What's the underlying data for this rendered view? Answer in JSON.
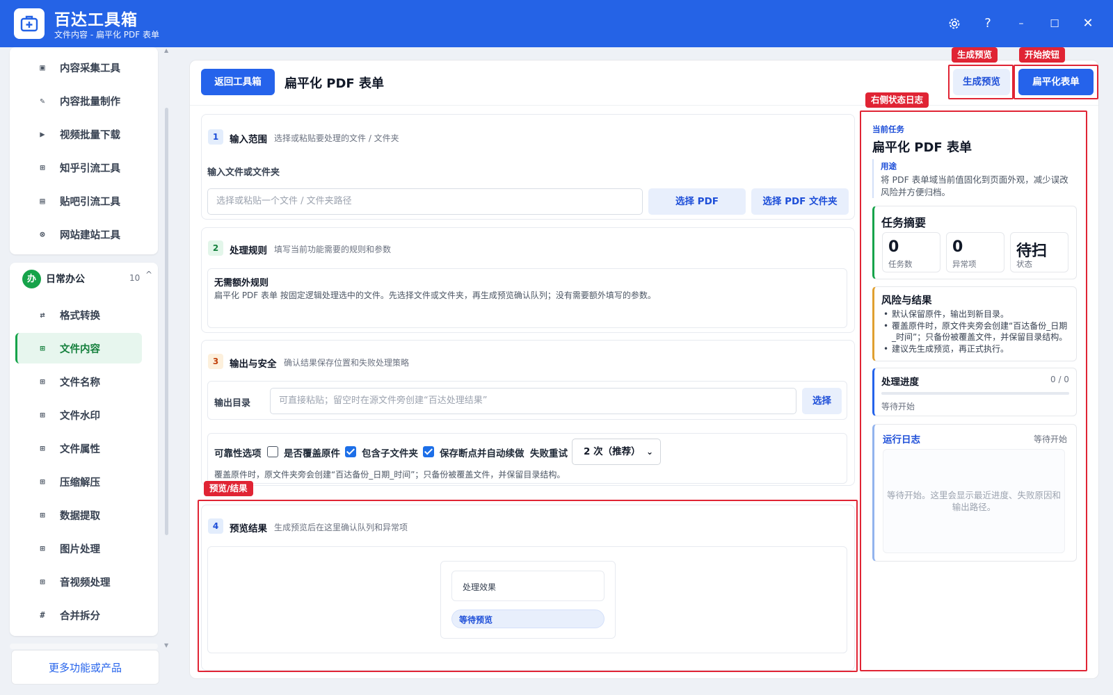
{
  "app": {
    "title": "百达工具箱",
    "subtitle": "文件内容 - 扁平化 PDF 表单"
  },
  "window_controls": {
    "settings_icon": "gear-icon",
    "help": "?",
    "minimize": "–",
    "maximize": "☐",
    "close": "✕"
  },
  "sidebar": {
    "top_items": [
      {
        "label": "内容采集工具",
        "icon": "▣"
      },
      {
        "label": "内容批量制作",
        "icon": "✎"
      },
      {
        "label": "视频批量下载",
        "icon": "▶"
      },
      {
        "label": "知乎引流工具",
        "icon": "⊞"
      },
      {
        "label": "贴吧引流工具",
        "icon": "▤"
      },
      {
        "label": "网站建站工具",
        "icon": "⊗"
      }
    ],
    "group": {
      "icon_text": "办",
      "label": "日常办公",
      "count": "10",
      "caret": "^"
    },
    "group_items": [
      {
        "label": "格式转换",
        "icon": "⇄",
        "active": false
      },
      {
        "label": "文件内容",
        "icon": "⊞",
        "active": true
      },
      {
        "label": "文件名称",
        "icon": "⊞",
        "active": false
      },
      {
        "label": "文件水印",
        "icon": "⊞",
        "active": false
      },
      {
        "label": "文件属性",
        "icon": "⊞",
        "active": false
      },
      {
        "label": "压缩解压",
        "icon": "⊞",
        "active": false
      },
      {
        "label": "数据提取",
        "icon": "⊞",
        "active": false
      },
      {
        "label": "图片处理",
        "icon": "⊞",
        "active": false
      },
      {
        "label": "音视频处理",
        "icon": "⊞",
        "active": false
      },
      {
        "label": "合并拆分",
        "icon": "#",
        "active": false
      }
    ],
    "more_button": "更多功能或产品"
  },
  "header": {
    "back_button": "返回工具箱",
    "title": "扁平化 PDF 表单",
    "preview_button": "生成预览",
    "start_button": "扁平化表单"
  },
  "annotations": {
    "preview_tag": "生成预览",
    "start_tag": "开始按钮",
    "status_tag": "右侧状态日志",
    "result_tag": "预览/结果"
  },
  "step1": {
    "num": "1",
    "title": "输入范围",
    "desc": "选择或粘贴要处理的文件 / 文件夹",
    "field_label": "输入文件或文件夹",
    "input_placeholder": "选择或粘贴一个文件 / 文件夹路径",
    "pick_pdf": "选择 PDF",
    "pick_folder": "选择 PDF 文件夹"
  },
  "step2": {
    "num": "2",
    "title": "处理规则",
    "desc": "填写当前功能需要的规则和参数",
    "rule_title": "无需额外规则",
    "rule_desc": "扁平化 PDF 表单 按固定逻辑处理选中的文件。先选择文件或文件夹，再生成预览确认队列；没有需要额外填写的参数。"
  },
  "step3": {
    "num": "3",
    "title": "输出与安全",
    "desc": "确认结果保存位置和失败处理策略",
    "output_label": "输出目录",
    "output_placeholder": "可直接粘贴；留空时在源文件旁创建“百达处理结果”",
    "output_button": "选择",
    "options_label": "可靠性选项",
    "opt_overwrite": "是否覆盖原件",
    "opt_overwrite_checked": false,
    "opt_subfolders": "包含子文件夹",
    "opt_subfolders_checked": true,
    "opt_resume": "保存断点并自动续做",
    "opt_resume_checked": true,
    "retry_label": "失败重试",
    "retry_value": "2 次（推荐）",
    "note": "覆盖原件时，原文件夹旁会创建“百达备份_日期_时间”；只备份被覆盖文件，并保留目录结构。"
  },
  "step4": {
    "num": "4",
    "title": "预览结果",
    "desc": "生成预览后在这里确认队列和异常项",
    "effect_label": "处理效果",
    "status_pill": "等待预览"
  },
  "right_panel": {
    "current_task_label": "当前任务",
    "task_title": "扁平化 PDF 表单",
    "purpose_label": "用途",
    "purpose_text": "将 PDF 表单域当前值固化到页面外观，减少误改风险并方便归档。",
    "summary_title": "任务摘要",
    "stats": [
      {
        "value": "0",
        "label": "任务数"
      },
      {
        "value": "0",
        "label": "异常项"
      },
      {
        "value": "待扫",
        "label": "状态"
      }
    ],
    "risk_title": "风险与结果",
    "risk_items": [
      "默认保留原件，输出到新目录。",
      "覆盖原件时，原文件夹旁会创建“百达备份_日期_时间”；只备份被覆盖文件，并保留目录结构。",
      "建议先生成预览，再正式执行。"
    ],
    "progress_title": "处理进度",
    "progress_count": "0 / 0",
    "progress_fraction": 0,
    "progress_status": "等待开始",
    "log_title": "运行日志",
    "log_status": "等待开始",
    "log_placeholder": "等待开始。这里会显示最近进度、失败原因和输出路径。"
  },
  "colors": {
    "brand_blue": "#2563e6",
    "accent_green": "#16a34a",
    "annotation_red": "#e02434"
  }
}
